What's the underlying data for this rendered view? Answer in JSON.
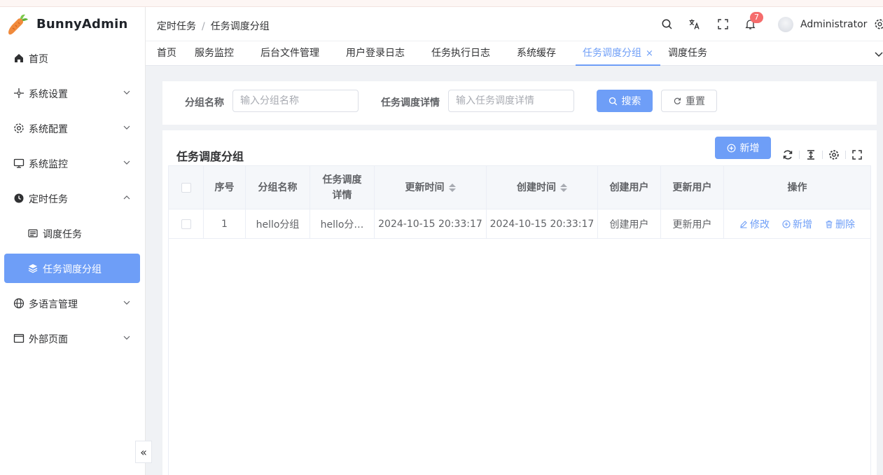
{
  "app": {
    "name": "BunnyAdmin"
  },
  "sidebar": {
    "items": [
      {
        "label": "首页",
        "icon": "home-icon"
      },
      {
        "label": "系统设置",
        "icon": "settings-nodes-icon"
      },
      {
        "label": "系统配置",
        "icon": "gear-icon"
      },
      {
        "label": "系统监控",
        "icon": "monitor-icon"
      },
      {
        "label": "定时任务",
        "icon": "clock-icon"
      },
      {
        "label": "调度任务",
        "icon": "schedule-icon"
      },
      {
        "label": "任务调度分组",
        "icon": "layers-icon"
      },
      {
        "label": "多语言管理",
        "icon": "globe-icon"
      },
      {
        "label": "外部页面",
        "icon": "window-icon"
      }
    ],
    "collapse_glyph": "«"
  },
  "header": {
    "breadcrumb": [
      "定时任务",
      "任务调度分组"
    ],
    "breadcrumb_sep": "/",
    "notifications_count": "7",
    "username": "Administrator"
  },
  "tabs": {
    "items": [
      "首页",
      "服务监控",
      "后台文件管理",
      "用户登录日志",
      "任务执行日志",
      "系统缓存",
      "任务调度分组",
      "调度任务"
    ],
    "active_close": "×"
  },
  "search": {
    "group_name_label": "分组名称",
    "group_name_placeholder": "输入分组名称",
    "detail_label": "任务调度详情",
    "detail_placeholder": "输入任务调度详情",
    "search_button": "搜索",
    "reset_button": "重置"
  },
  "table_card": {
    "title": "任务调度分组",
    "add_button": "新增"
  },
  "table": {
    "headers": {
      "index": "序号",
      "group_name": "分组名称",
      "detail_line1": "任务调度",
      "detail_line2": "详情",
      "update_time": "更新时间",
      "create_time": "创建时间",
      "create_user": "创建用户",
      "update_user": "更新用户",
      "actions": "操作"
    },
    "rows": [
      {
        "index": "1",
        "group_name": "hello分组",
        "detail": "hello分…",
        "update_time": "2024-10-15 20:33:17",
        "create_time": "2024-10-15 20:33:17",
        "create_user": "创建用户",
        "update_user": "更新用户",
        "edit": "修改",
        "add": "新增",
        "delete": "删除"
      }
    ]
  },
  "colors": {
    "primary": "#6e9ef7",
    "danger_badge": "#f56c6c",
    "text": "#303133",
    "muted": "#606266",
    "border": "#ebeef5"
  }
}
